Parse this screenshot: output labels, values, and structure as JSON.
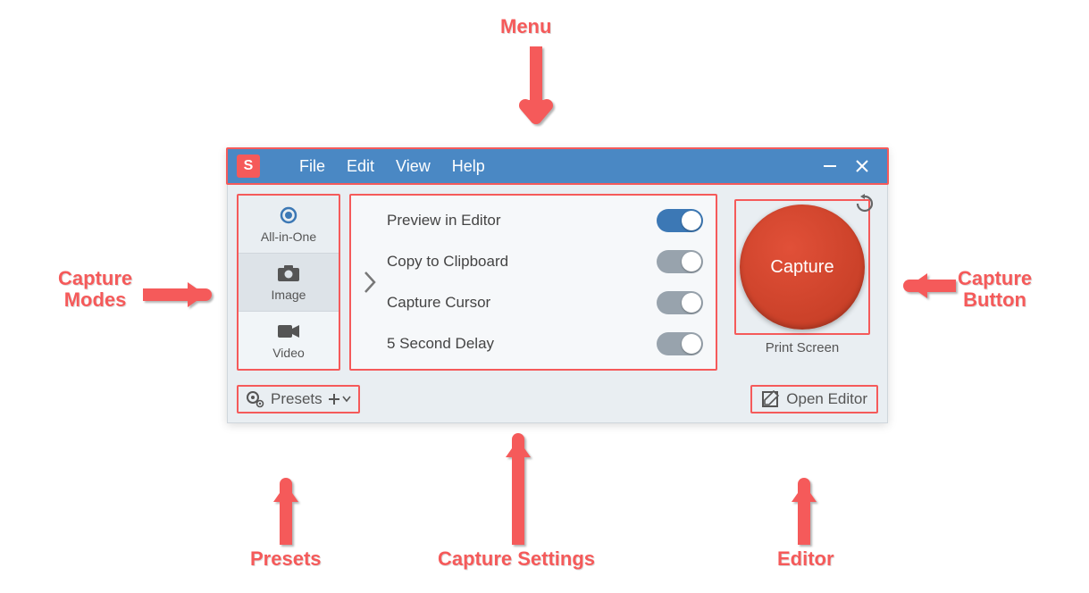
{
  "annotations": {
    "menu": "Menu",
    "capture_modes": "Capture\nModes",
    "capture_button": "Capture\nButton",
    "presets": "Presets",
    "capture_settings": "Capture Settings",
    "editor": "Editor"
  },
  "titlebar": {
    "logo_letter": "S",
    "menu": {
      "file": "File",
      "edit": "Edit",
      "view": "View",
      "help": "Help"
    }
  },
  "modes": {
    "all_in_one": "All-in-One",
    "image": "Image",
    "video": "Video"
  },
  "settings": {
    "preview_in_editor": {
      "label": "Preview in Editor",
      "on": true
    },
    "copy_to_clipboard": {
      "label": "Copy to Clipboard",
      "on": false
    },
    "capture_cursor": {
      "label": "Capture Cursor",
      "on": false
    },
    "five_second_delay": {
      "label": "5 Second Delay",
      "on": false
    }
  },
  "capture": {
    "button_label": "Capture",
    "hotkey": "Print Screen"
  },
  "footer": {
    "presets_label": "Presets",
    "open_editor_label": "Open Editor"
  }
}
